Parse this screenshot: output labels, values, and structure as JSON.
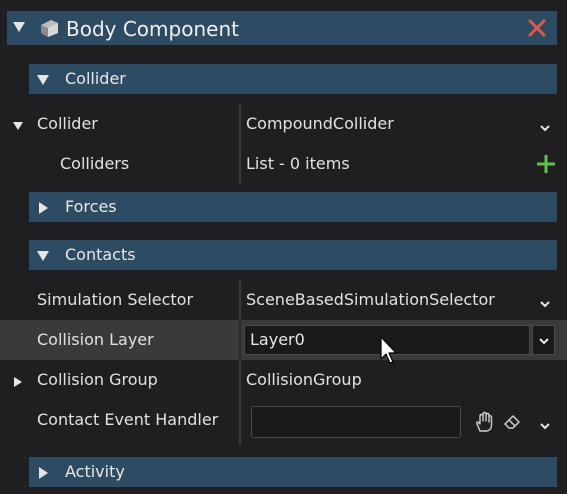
{
  "component": {
    "title": "Body Component",
    "icon": "cube-icon",
    "close_icon": "close-x-icon"
  },
  "sections": {
    "collider": "Collider",
    "forces": "Forces",
    "contacts": "Contacts",
    "activity": "Activity"
  },
  "properties": {
    "collider": {
      "name": "Collider",
      "value": "CompoundCollider"
    },
    "colliders": {
      "name": "Colliders",
      "value": "List - 0 items"
    },
    "simulation_selector": {
      "name": "Simulation Selector",
      "value": "SceneBasedSimulationSelector"
    },
    "collision_layer": {
      "name": "Collision Layer",
      "value": "Layer0"
    },
    "collision_group": {
      "name": "Collision Group",
      "value": "CollisionGroup"
    },
    "contact_event_handler": {
      "name": "Contact Event Handler",
      "value": ""
    }
  },
  "colors": {
    "header_bg": "#2d4b63",
    "panel_bg": "#1f1f21",
    "close_red": "#e05a4a",
    "add_green": "#5cc24a"
  }
}
